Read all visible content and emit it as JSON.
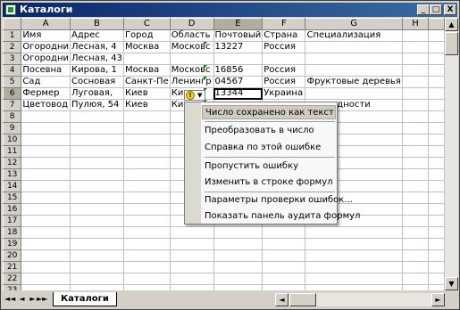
{
  "window": {
    "title": "Каталоги",
    "minimize": "_",
    "maximize": "□",
    "close": "X"
  },
  "columns": [
    "A",
    "B",
    "C",
    "D",
    "E",
    "F",
    "G",
    "H"
  ],
  "rows": [
    [
      "Имя",
      "Адрес",
      "Город",
      "Область",
      "Почтовый",
      "Страна",
      "Специализация",
      ""
    ],
    [
      "Огородни",
      "Лесная, 4",
      "Москва",
      "Московс",
      "13227",
      "Россия",
      "",
      ""
    ],
    [
      "Огородни",
      "Лесная, 43",
      "",
      "",
      "",
      "",
      "",
      ""
    ],
    [
      "Посевна",
      "Кирова, 1",
      "Москва",
      "Московс",
      "16856",
      "Россия",
      "",
      ""
    ],
    [
      "Сад",
      "Сосновая",
      "Санкт-Пе",
      "Ленингр",
      "04567",
      "Россия",
      "Фруктовые деревья",
      ""
    ],
    [
      "Фермер",
      "Луговая,",
      "Киев",
      "Киев",
      "13344",
      "Украина",
      "",
      ""
    ],
    [
      "Цветовод",
      "Пулюя, 54",
      "Киев",
      "Киев",
      "",
      "",
      "…зовидности",
      ""
    ],
    [
      "",
      "",
      "",
      "",
      "",
      "",
      "",
      ""
    ],
    [
      "",
      "",
      "",
      "",
      "",
      "",
      "",
      ""
    ],
    [
      "",
      "",
      "",
      "",
      "",
      "",
      "",
      ""
    ],
    [
      "",
      "",
      "",
      "",
      "",
      "",
      "",
      ""
    ],
    [
      "",
      "",
      "",
      "",
      "",
      "",
      "",
      ""
    ],
    [
      "",
      "",
      "",
      "",
      "",
      "",
      "",
      ""
    ],
    [
      "",
      "",
      "",
      "",
      "",
      "",
      "",
      ""
    ],
    [
      "",
      "",
      "",
      "",
      "",
      "",
      "",
      ""
    ],
    [
      "",
      "",
      "",
      "",
      "",
      "",
      "",
      ""
    ],
    [
      "",
      "",
      "",
      "",
      "",
      "",
      "",
      ""
    ],
    [
      "",
      "",
      "",
      "",
      "",
      "",
      "",
      ""
    ],
    [
      "",
      "",
      "",
      "",
      "",
      "",
      "",
      ""
    ],
    [
      "",
      "",
      "",
      "",
      "",
      "",
      "",
      ""
    ],
    [
      "",
      "",
      "",
      "",
      "",
      "",
      "",
      ""
    ],
    [
      "",
      "",
      "",
      "",
      "",
      "",
      "",
      ""
    ],
    [
      "",
      "",
      "",
      "",
      "",
      "",
      "",
      ""
    ]
  ],
  "row_numbers": [
    "1",
    "2",
    "3",
    "4",
    "5",
    "6",
    "7",
    "8",
    "9",
    "10",
    "11",
    "12",
    "13",
    "14",
    "15",
    "16",
    "17",
    "18",
    "19",
    "20",
    "21",
    "22",
    "23"
  ],
  "smart_tag": {
    "icon": "exclamation-warning-icon",
    "symbol": "!",
    "arrow": "▼"
  },
  "context_menu": [
    "Число сохранено как текст",
    "Преобразовать в число",
    "Справка по этой ошибке",
    "Пропустить ошибку",
    "Изменить в строке формул",
    "Параметры проверки ошибок...",
    "Показать панель аудита формул"
  ],
  "sheet_tab": "Каталоги",
  "nav": {
    "first": "◄◄",
    "prev": "◄",
    "next": "►",
    "last": "►►"
  },
  "scroll": {
    "up": "▲",
    "down": "▼",
    "left": "◄",
    "right": "►"
  },
  "colors": {
    "title_bar": "#0a246a",
    "error_indicator": "#008000",
    "menu_highlight": "#cfcbc3"
  }
}
